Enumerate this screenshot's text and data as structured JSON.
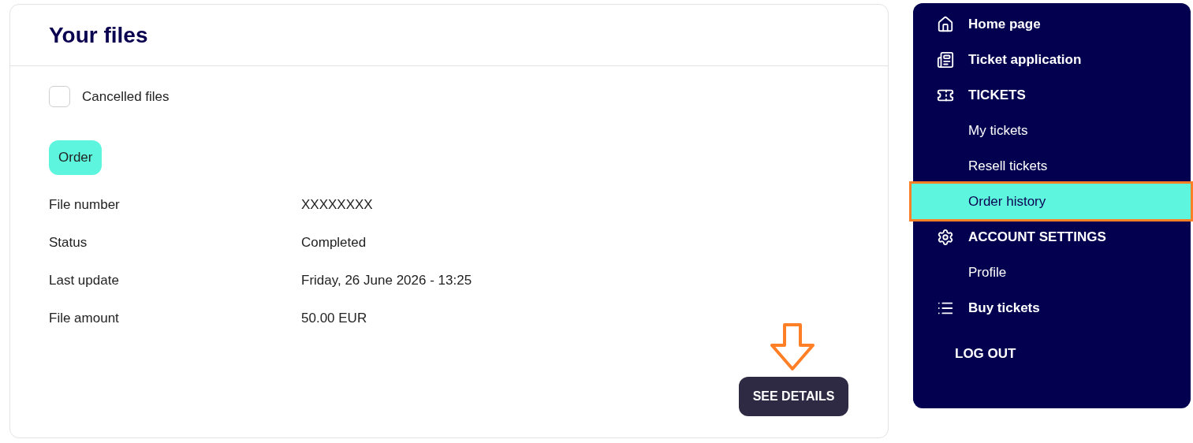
{
  "main": {
    "title": "Your files",
    "filter": {
      "label": "Cancelled files",
      "checked": false
    },
    "badge": "Order",
    "fields": [
      {
        "label": "File number",
        "value": "XXXXXXXX"
      },
      {
        "label": "Status",
        "value": "Completed"
      },
      {
        "label": "Last update",
        "value": "Friday, 26 June 2026 - 13:25"
      },
      {
        "label": "File amount",
        "value": "50.00 EUR"
      }
    ],
    "button": "SEE DETAILS"
  },
  "sidebar": {
    "items": [
      {
        "label": "Home page",
        "kind": "main",
        "selected": false
      },
      {
        "label": "Ticket application",
        "kind": "main",
        "selected": false
      },
      {
        "label": "TICKETS",
        "kind": "main",
        "selected": false
      },
      {
        "label": "My tickets",
        "kind": "sub",
        "selected": false
      },
      {
        "label": "Resell tickets",
        "kind": "sub",
        "selected": false
      },
      {
        "label": "Order history",
        "kind": "sub",
        "selected": true
      },
      {
        "label": "ACCOUNT SETTINGS",
        "kind": "main",
        "selected": false
      },
      {
        "label": "Profile",
        "kind": "sub",
        "selected": false
      },
      {
        "label": "Buy tickets",
        "kind": "main",
        "selected": false
      }
    ],
    "logout": "LOG OUT"
  }
}
